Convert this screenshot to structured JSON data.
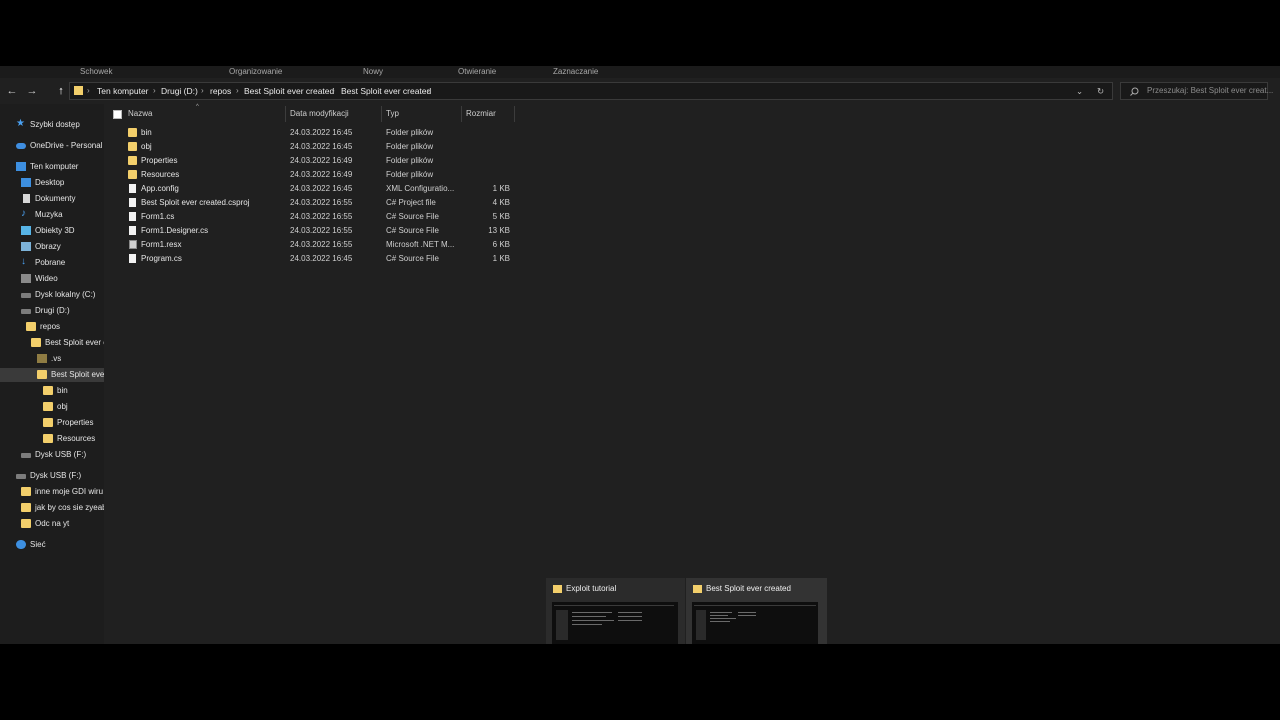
{
  "ribbon": {
    "tabs": [
      "Schowek",
      "Organizowanie",
      "Nowy",
      "Otwieranie",
      "Zaznaczanie"
    ]
  },
  "nav": {
    "back_icon": "←",
    "forward_icon": "→",
    "up_icon": "↑",
    "dropdown_icon": "⌄",
    "refresh_icon": "↻",
    "sep": "›"
  },
  "breadcrumb": [
    "Ten komputer",
    "Drugi (D:)",
    "repos",
    "Best Sploit ever created",
    "Best Sploit ever created"
  ],
  "search": {
    "placeholder": "Przeszukaj: Best Sploit ever creat..."
  },
  "sidebar": {
    "items": [
      {
        "label": "Szybki dostęp",
        "icon": "star-icon"
      },
      {
        "label": "OneDrive - Personal",
        "icon": "cloud-icon"
      },
      {
        "label": "Ten komputer",
        "icon": "computer-icon"
      },
      {
        "label": "Desktop",
        "icon": "desktop-icon"
      },
      {
        "label": "Dokumenty",
        "icon": "document-icon"
      },
      {
        "label": "Muzyka",
        "icon": "music-icon"
      },
      {
        "label": "Obiekty 3D",
        "icon": "cube-icon"
      },
      {
        "label": "Obrazy",
        "icon": "pictures-icon"
      },
      {
        "label": "Pobrane",
        "icon": "download-icon"
      },
      {
        "label": "Wideo",
        "icon": "video-icon"
      },
      {
        "label": "Dysk lokalny (C:)",
        "icon": "drive-icon"
      },
      {
        "label": "Drugi (D:)",
        "icon": "drive-icon"
      },
      {
        "label": "repos",
        "icon": "folder-icon"
      },
      {
        "label": "Best Sploit ever c",
        "icon": "folder-icon"
      },
      {
        "label": ".vs",
        "icon": "folder-icon"
      },
      {
        "label": "Best Sploit ever",
        "icon": "folder-icon"
      },
      {
        "label": "bin",
        "icon": "folder-icon"
      },
      {
        "label": "obj",
        "icon": "folder-icon"
      },
      {
        "label": "Properties",
        "icon": "folder-icon"
      },
      {
        "label": "Resources",
        "icon": "folder-icon"
      },
      {
        "label": "Dysk USB (F:)",
        "icon": "usb-drive-icon"
      },
      {
        "label": "Dysk USB (F:)",
        "icon": "usb-drive-icon"
      },
      {
        "label": "inne moje GDI wiru",
        "icon": "folder-icon"
      },
      {
        "label": "jak by cos sie zyeab",
        "icon": "folder-icon"
      },
      {
        "label": "Odc na yt",
        "icon": "folder-icon"
      },
      {
        "label": "Sieć",
        "icon": "network-icon"
      }
    ]
  },
  "columns": {
    "name": "Nazwa",
    "date": "Data modyfikacji",
    "type": "Typ",
    "size": "Rozmiar"
  },
  "files": [
    {
      "name": "bin",
      "date": "24.03.2022 16:45",
      "type": "Folder plików",
      "size": "",
      "kind": "folder"
    },
    {
      "name": "obj",
      "date": "24.03.2022 16:45",
      "type": "Folder plików",
      "size": "",
      "kind": "folder"
    },
    {
      "name": "Properties",
      "date": "24.03.2022 16:49",
      "type": "Folder plików",
      "size": "",
      "kind": "folder"
    },
    {
      "name": "Resources",
      "date": "24.03.2022 16:49",
      "type": "Folder plików",
      "size": "",
      "kind": "folder"
    },
    {
      "name": "App.config",
      "date": "24.03.2022 16:45",
      "type": "XML Configuratio...",
      "size": "1 KB",
      "kind": "file"
    },
    {
      "name": "Best Sploit ever created.csproj",
      "date": "24.03.2022 16:55",
      "type": "C# Project file",
      "size": "4 KB",
      "kind": "file"
    },
    {
      "name": "Form1.cs",
      "date": "24.03.2022 16:55",
      "type": "C# Source File",
      "size": "5 KB",
      "kind": "file"
    },
    {
      "name": "Form1.Designer.cs",
      "date": "24.03.2022 16:55",
      "type": "C# Source File",
      "size": "13 KB",
      "kind": "file"
    },
    {
      "name": "Form1.resx",
      "date": "24.03.2022 16:55",
      "type": "Microsoft .NET M...",
      "size": "6 KB",
      "kind": "file"
    },
    {
      "name": "Program.cs",
      "date": "24.03.2022 16:45",
      "type": "C# Source File",
      "size": "1 KB",
      "kind": "file"
    }
  ],
  "taskbar_previews": [
    {
      "title": "Exploit tutorial"
    },
    {
      "title": "Best Sploit ever created"
    }
  ]
}
